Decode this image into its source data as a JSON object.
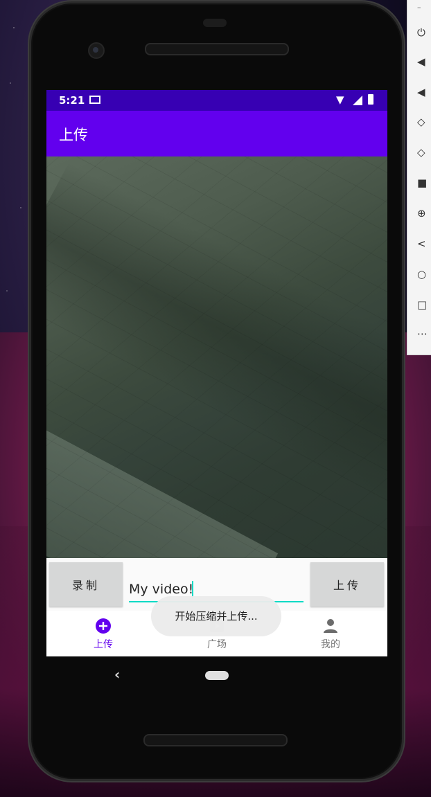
{
  "status_bar": {
    "time": "5:21"
  },
  "app_bar": {
    "title": "上传"
  },
  "controls": {
    "record_label": "录制",
    "upload_label": "上传",
    "caption_value": "My video!"
  },
  "toast": {
    "message": "开始压缩并上传..."
  },
  "bottom_nav": {
    "items": [
      {
        "label": "上传",
        "icon": "add-circle-icon",
        "active": true
      },
      {
        "label": "广场",
        "icon": "video-play-icon",
        "active": false
      },
      {
        "label": "我的",
        "icon": "person-icon",
        "active": false
      }
    ]
  },
  "emulator_toolbar": {
    "tools": [
      "power-icon",
      "volume-up-icon",
      "volume-down-icon",
      "rotate-left-icon",
      "rotate-right-icon",
      "camera-icon",
      "zoom-icon",
      "back-icon",
      "home-icon",
      "overview-icon",
      "more-icon"
    ]
  },
  "colors": {
    "status_bar": "#3700b3",
    "app_bar": "#6200ee",
    "accent": "#03dac5",
    "nav_active": "#6200ee"
  }
}
